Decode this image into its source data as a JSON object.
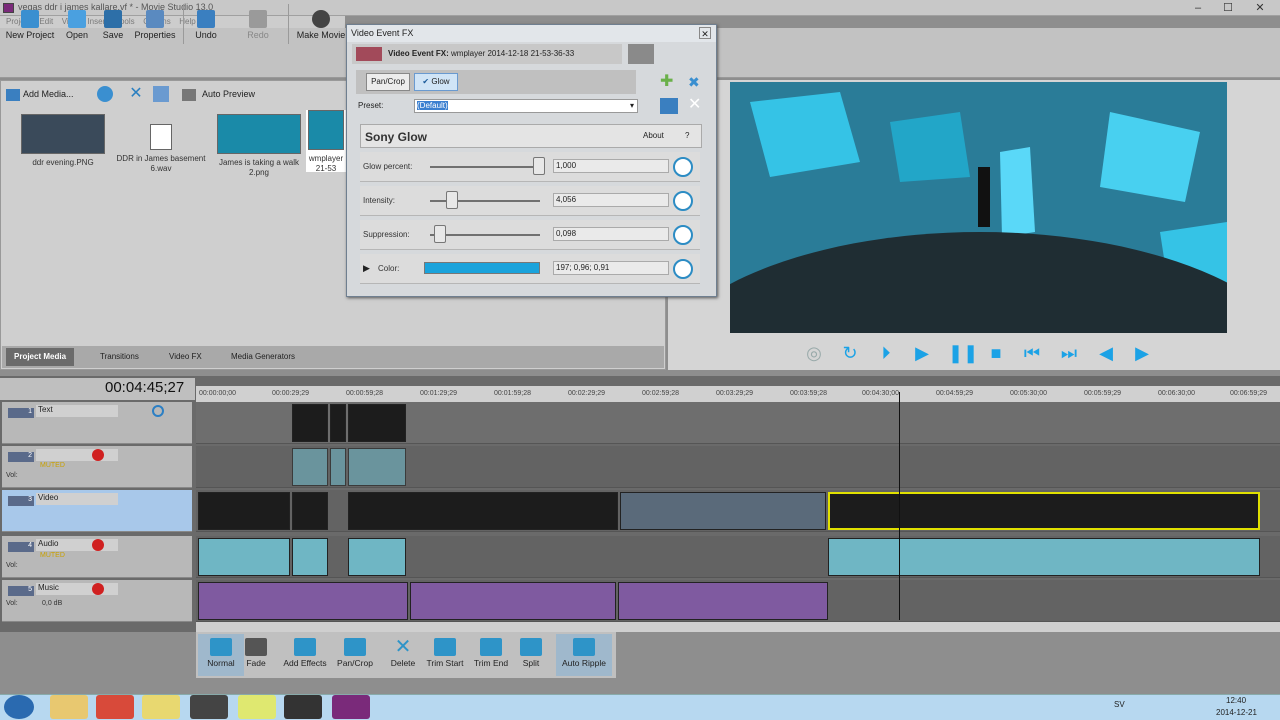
{
  "window": {
    "title": "vegas ddr i james kallare.vf * - Movie Studio 13.0",
    "minimize": "–",
    "maximize": "☐",
    "close": "✕"
  },
  "menu": [
    "Project",
    "Edit",
    "View",
    "Insert",
    "Tools",
    "Options",
    "Help"
  ],
  "toolbar": {
    "items": [
      "New Project",
      "Open",
      "Save",
      "Properties",
      "Undo",
      "Redo",
      "Make Movie"
    ]
  },
  "media": {
    "add_label": "Add Media...",
    "auto_preview": "Auto Preview",
    "items": [
      {
        "caption": "ddr evening.PNG"
      },
      {
        "caption": "DDR in James basement 6.wav"
      },
      {
        "caption": "James is taking a walk 2.png"
      },
      {
        "caption": "wmplayer 21-53"
      }
    ],
    "tabs": [
      "Project Media",
      "Transitions",
      "Video FX",
      "Media Generators"
    ]
  },
  "fx": {
    "title": "Video Event FX",
    "event_label": "Video Event FX:",
    "event_name": "wmplayer 2014-12-18 21-53-36-33",
    "chain": [
      "Pan/Crop",
      "Glow"
    ],
    "preset_label": "Preset:",
    "preset_value": "(Default)",
    "plugin": "Sony Glow",
    "about": "About",
    "help": "?",
    "params": [
      {
        "label": "Glow percent:",
        "value": "1,000",
        "pos": 1.0
      },
      {
        "label": "Intensity:",
        "value": "4,056",
        "pos": 0.2
      },
      {
        "label": "Suppression:",
        "value": "0,098",
        "pos": 0.1
      }
    ],
    "color_label": "Color:",
    "color_value": "197; 0,96; 0,91",
    "color_hex": "#1aa3dc"
  },
  "timeline": {
    "timecode": "00:04:45;27",
    "ruler": [
      "00:00:00;00",
      "00:00:29;29",
      "00:00:59;28",
      "00:01:29;29",
      "00:01:59;28",
      "00:02:29;29",
      "00:02:59;28",
      "00:03:29;29",
      "00:03:59;28",
      "00:04:30;00",
      "00:04:59;29",
      "00:05:30;00",
      "00:05:59;29",
      "00:06:30;00",
      "00:06:59;29"
    ],
    "tracks": [
      {
        "num": "1",
        "name": "Text"
      },
      {
        "num": "2",
        "name": "",
        "vol": "Vol:",
        "muted": "MUTED"
      },
      {
        "num": "3",
        "name": "Video"
      },
      {
        "num": "4",
        "name": "Audio",
        "vol": "Vol:",
        "muted": "MUTED"
      },
      {
        "num": "5",
        "name": "Music",
        "vol": "Vol:",
        "db": "0,0 dB"
      }
    ]
  },
  "editbar": [
    "Normal",
    "Fade",
    "Add Effects",
    "Pan/Crop",
    "Delete",
    "Trim Start",
    "Trim End",
    "Split",
    "Auto Ripple"
  ],
  "taskbar": {
    "lang": "SV",
    "time": "12:40",
    "date": "2014-12-21"
  },
  "colors": {
    "accent": "#1ba2e6",
    "playhead": "#111111"
  }
}
